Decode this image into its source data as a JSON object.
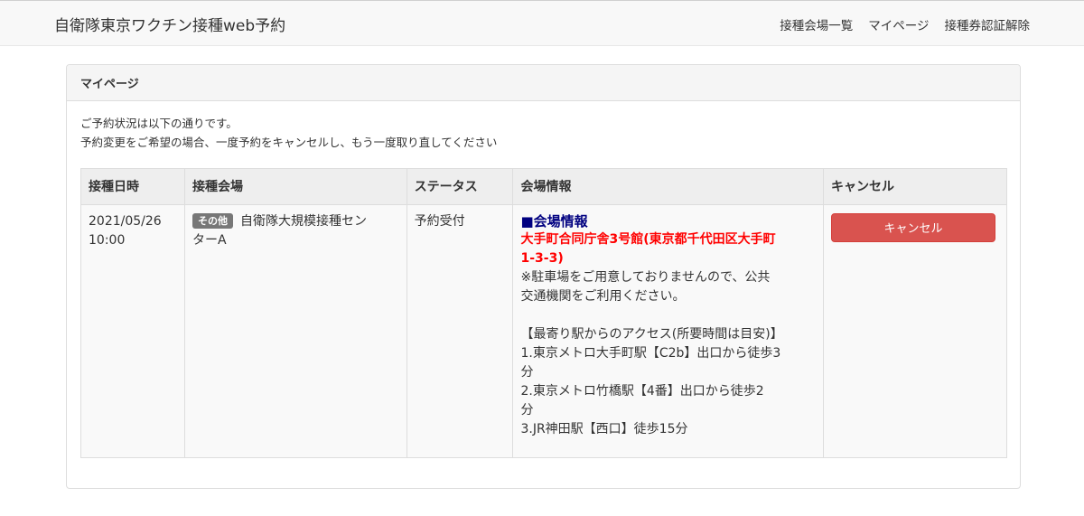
{
  "navbar": {
    "brand": "自衛隊東京ワクチン接種web予約",
    "links": [
      "接種会場一覧",
      "マイページ",
      "接種券認証解除"
    ]
  },
  "panel": {
    "title": "マイページ",
    "intro": [
      "ご予約状況は以下の通りです。",
      "予約変更をご希望の場合、一度予約をキャンセルし、もう一度取り直してください"
    ]
  },
  "table": {
    "headers": [
      "接種日時",
      "接種会場",
      "ステータス",
      "会場情報",
      "キャンセル"
    ],
    "row": {
      "date": "2021/05/26",
      "time": "10:00",
      "venue_badge": "その他",
      "venue_name_line1": "自衛隊大規模接種セン",
      "venue_name_line2": "ターA",
      "status": "予約受付",
      "info": {
        "heading": "■会場情報",
        "address_line1": "大手町合同庁舎3号館(東京都千代田区大手町",
        "address_line2": "1-3-3)",
        "parking_line1": "※駐車場をご用意しておりませんので、公共",
        "parking_line2": "交通機関をご利用ください。",
        "access_heading": "【最寄り駅からのアクセス(所要時間は目安)】",
        "access1_line1": "1.東京メトロ大手町駅【C2b】出口から徒歩3",
        "access1_line2": "分",
        "access2_line1": "2.東京メトロ竹橋駅【4番】出口から徒歩2",
        "access2_line2": "分",
        "access3": "3.JR神田駅【西口】徒歩15分"
      },
      "cancel_label": "キャンセル"
    }
  },
  "colors": {
    "cancel_button": "#d9534f",
    "venue_heading": "#000080",
    "address": "#ff0000",
    "badge": "#777777"
  }
}
